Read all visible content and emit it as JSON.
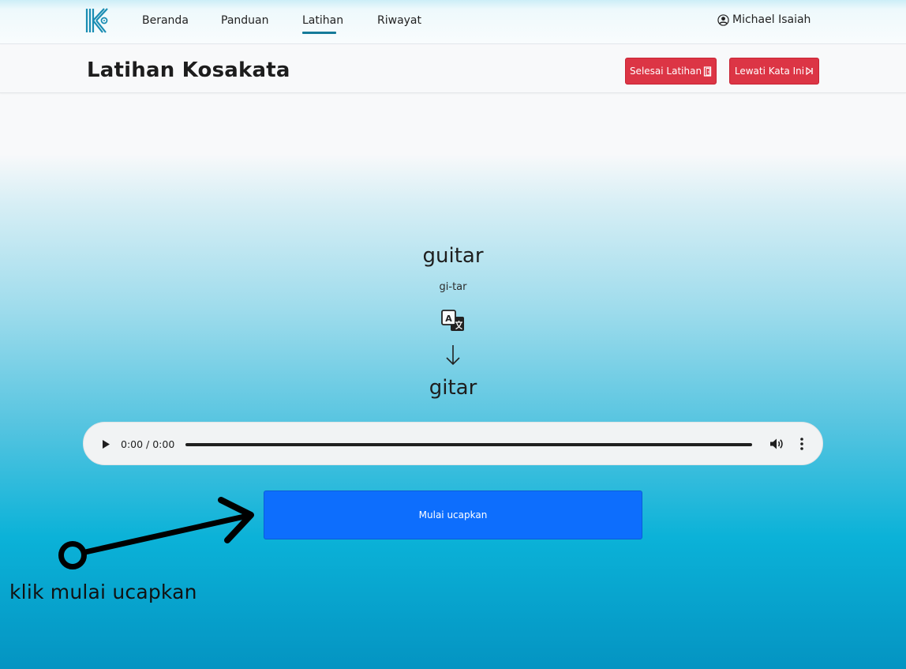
{
  "navbar": {
    "items": [
      {
        "label": "Beranda"
      },
      {
        "label": "Panduan"
      },
      {
        "label": "Latihan"
      },
      {
        "label": "Riwayat"
      }
    ],
    "active_item": "Latihan",
    "user_name": "Michael Isaiah"
  },
  "header": {
    "title": "Latihan Kosakata",
    "finish_button": "Selesai Latihan",
    "skip_button": "Lewati Kata Ini"
  },
  "word": {
    "english": "guitar",
    "syllables": "gi-tar",
    "indonesian": "gitar"
  },
  "audio": {
    "time": "0:00 / 0:00"
  },
  "action": {
    "start_button": "Mulai ucapkan"
  },
  "annotation": {
    "text": "klik mulai ucapkan"
  },
  "colors": {
    "accent": "#157a99",
    "danger": "#dc3545",
    "primary": "#0d6efd"
  }
}
